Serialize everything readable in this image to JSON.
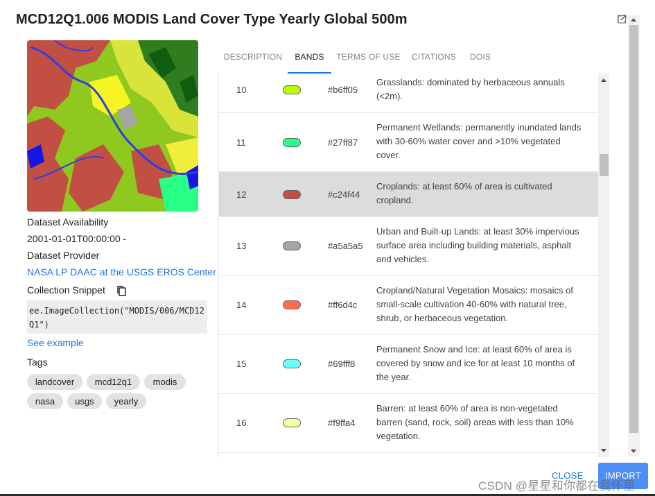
{
  "title": "MCD12Q1.006 MODIS Land Cover Type Yearly Global 500m",
  "sidebar": {
    "availability_label": "Dataset Availability",
    "availability_value": "2001-01-01T00:00:00 -",
    "provider_label": "Dataset Provider",
    "provider_link": "NASA LP DAAC at the USGS EROS Center",
    "snippet_label": "Collection Snippet",
    "snippet_code": "ee.ImageCollection(\"MODIS/006/MCD12Q1\")",
    "see_example": "See example",
    "tags_label": "Tags",
    "tags": [
      "landcover",
      "mcd12q1",
      "modis",
      "nasa",
      "usgs",
      "yearly"
    ]
  },
  "tabs": [
    {
      "label": "DESCRIPTION",
      "active": false
    },
    {
      "label": "BANDS",
      "active": true
    },
    {
      "label": "TERMS OF USE",
      "active": false
    },
    {
      "label": "CITATIONS",
      "active": false
    },
    {
      "label": "DOIS",
      "active": false
    }
  ],
  "bands": [
    {
      "value": "10",
      "color": "#b6ff05",
      "hex": "#b6ff05",
      "description": "Grasslands: dominated by herbaceous annuals (<2m).",
      "selected": false
    },
    {
      "value": "11",
      "color": "#27ff87",
      "hex": "#27ff87",
      "description": "Permanent Wetlands: permanently inundated lands with 30-60% water cover and >10% vegetated cover.",
      "selected": false
    },
    {
      "value": "12",
      "color": "#c24f44",
      "hex": "#c24f44",
      "description": "Croplands: at least 60% of area is cultivated cropland.",
      "selected": true
    },
    {
      "value": "13",
      "color": "#a5a5a5",
      "hex": "#a5a5a5",
      "description": "Urban and Built-up Lands: at least 30% impervious surface area including building materials, asphalt and vehicles.",
      "selected": false
    },
    {
      "value": "14",
      "color": "#ff6d4c",
      "hex": "#ff6d4c",
      "description": "Cropland/Natural Vegetation Mosaics: mosaics of small-scale cultivation 40-60% with natural tree, shrub, or herbaceous vegetation.",
      "selected": false
    },
    {
      "value": "15",
      "color": "#69fff8",
      "hex": "#69fff8",
      "description": "Permanent Snow and Ice: at least 60% of area is covered by snow and ice for at least 10 months of the year.",
      "selected": false
    },
    {
      "value": "16",
      "color": "#f9ffa4",
      "hex": "#f9ffa4",
      "description": "Barren: at least 60% of area is non-vegetated barren (sand, rock, soil) areas with less than 10% vegetation.",
      "selected": false
    }
  ],
  "footer": {
    "close_label": "CLOSE",
    "import_label": "IMPORT"
  },
  "watermark": "CSDN @星星和你都在我怀里",
  "icons": {
    "open_in_new": "open-in-new-icon",
    "copy": "copy-icon"
  },
  "colors": {
    "accent": "#1a73e8",
    "import_button": "#4c8df6",
    "selected_row": "#dcdcdc"
  }
}
